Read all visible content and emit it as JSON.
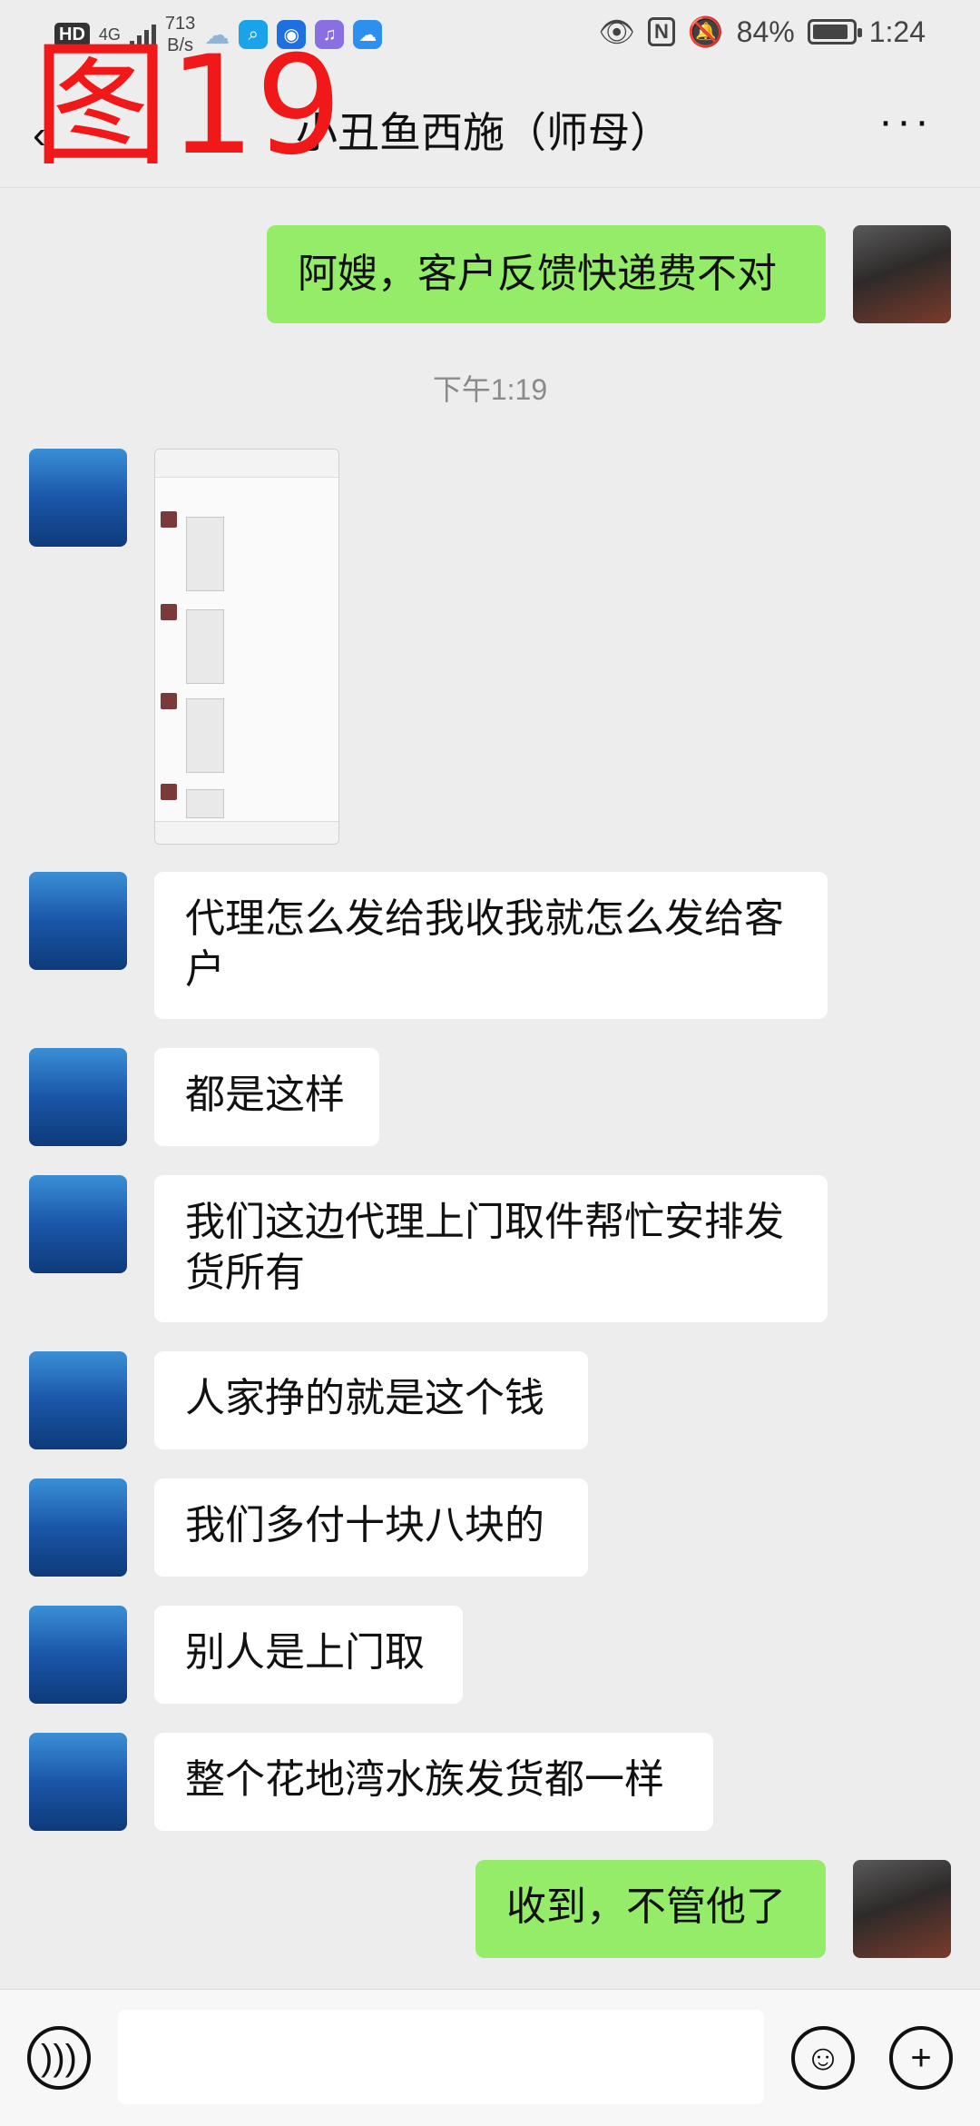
{
  "overlay_label": "图19",
  "status_bar": {
    "hd": "HD",
    "network": "4G",
    "speed": "713",
    "speed_unit": "B/s",
    "battery": "84%",
    "time": "1:24"
  },
  "header": {
    "title": "小丑鱼西施（师母）"
  },
  "timestamp": "下午1:19",
  "messages": [
    {
      "sender": "me",
      "text": "阿嫂，客户反馈快递费不对"
    },
    {
      "sender": "contact",
      "text": "代理怎么发给我收我就怎么发给客户"
    },
    {
      "sender": "contact",
      "text": "都是这样"
    },
    {
      "sender": "contact",
      "text": "我们这边代理上门取件帮忙安排发货所有"
    },
    {
      "sender": "contact",
      "text": "人家挣的就是这个钱"
    },
    {
      "sender": "contact",
      "text": "我们多付十块八块的"
    },
    {
      "sender": "contact",
      "text": "别人是上门取"
    },
    {
      "sender": "contact",
      "text": "整个花地湾水族发货都一样"
    },
    {
      "sender": "me",
      "text": "收到，不管他了"
    }
  ],
  "colors": {
    "outgoing_bubble": "#95ec69",
    "incoming_bubble": "#ffffff",
    "background": "#ededed",
    "overlay": "#f01818"
  },
  "icons": [
    "back-icon",
    "more-icon",
    "voice-icon",
    "emoji-icon",
    "plus-icon",
    "eye-icon",
    "nfc-icon",
    "mute-icon"
  ]
}
